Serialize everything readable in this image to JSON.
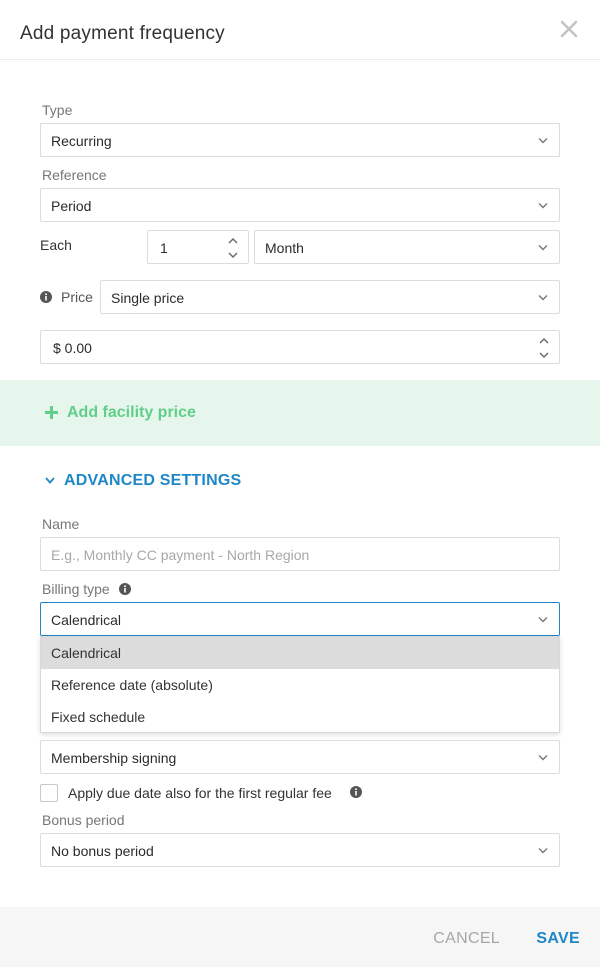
{
  "dialog": {
    "title": "Add payment frequency"
  },
  "icons": {
    "close": "close-icon",
    "chevron": "chevron-down-icon",
    "info": "info-icon",
    "plus": "plus-icon",
    "stepper": "stepper-icon"
  },
  "colors": {
    "accent": "#1f87c7",
    "facility_bg": "#e6f6ec",
    "facility_text": "#5fcf8a",
    "cancel": "#a7a7a7"
  },
  "form": {
    "type": {
      "label": "Type",
      "value": "Recurring"
    },
    "reference": {
      "label": "Reference",
      "value": "Period"
    },
    "each": {
      "label": "Each",
      "count": "1",
      "unit": "Month"
    },
    "price": {
      "label": "Price",
      "mode": "Single price",
      "amount": "$ 0.00"
    }
  },
  "facility": {
    "label": "Add facility price"
  },
  "advanced": {
    "title": "ADVANCED SETTINGS",
    "name": {
      "label": "Name",
      "placeholder": "E.g., Monthly CC payment - North Region"
    },
    "billing_type": {
      "label": "Billing type",
      "value": "Calendrical",
      "options": [
        "Calendrical",
        "Reference date (absolute)",
        "Fixed schedule"
      ]
    },
    "due_reference": {
      "value": "Membership signing"
    },
    "apply_due_date": {
      "label": "Apply due date also for the first regular fee",
      "checked": false
    },
    "bonus_period": {
      "label": "Bonus period",
      "value": "No bonus period"
    }
  },
  "footer": {
    "cancel": "CANCEL",
    "save": "SAVE"
  }
}
